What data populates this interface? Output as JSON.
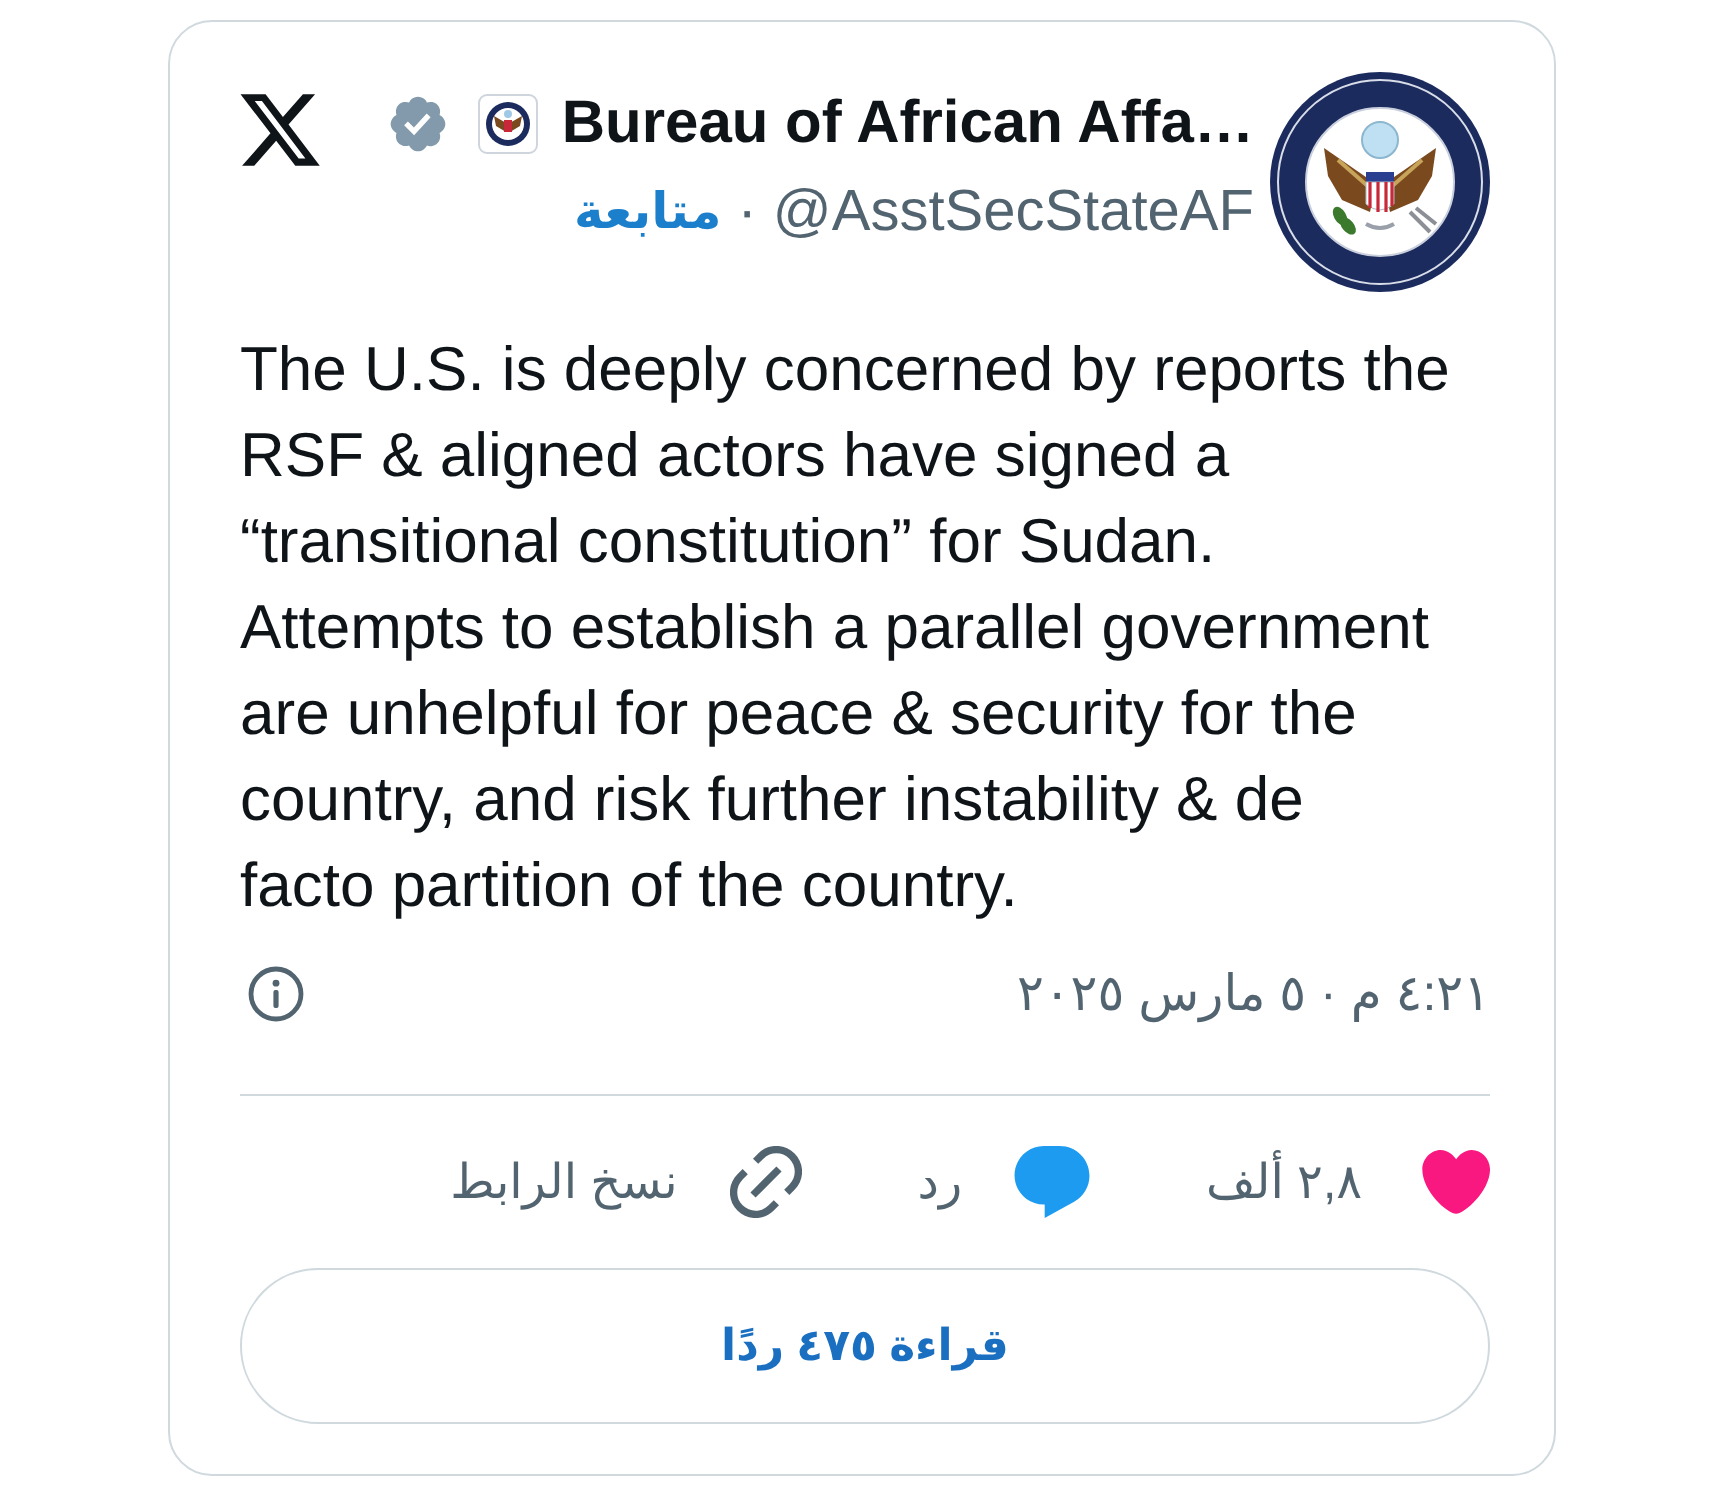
{
  "author": {
    "name": "Bureau of African Affa…",
    "verified": true,
    "handle": "@AsstSecStateAF",
    "separator": "·",
    "follow_label": "متابعة"
  },
  "post": {
    "text": "The U.S. is deeply concerned by reports the RSF & aligned actors have signed a “transitional constitution” for Sudan. Attempts to establish a parallel government are unhelpful for peace & security for the country, and risk further instability & de facto partition of the country.",
    "timestamp": "٤:٢١ م · ٥ مارس ٢٠٢٥"
  },
  "actions": [
    {
      "kind": "like",
      "label": "٢,٨ ألف"
    },
    {
      "kind": "reply",
      "label": "رد"
    },
    {
      "kind": "copy_link",
      "label": "نسخ الرابط"
    }
  ],
  "read_replies_button": "قراءة ٤٧٥ ردًا"
}
